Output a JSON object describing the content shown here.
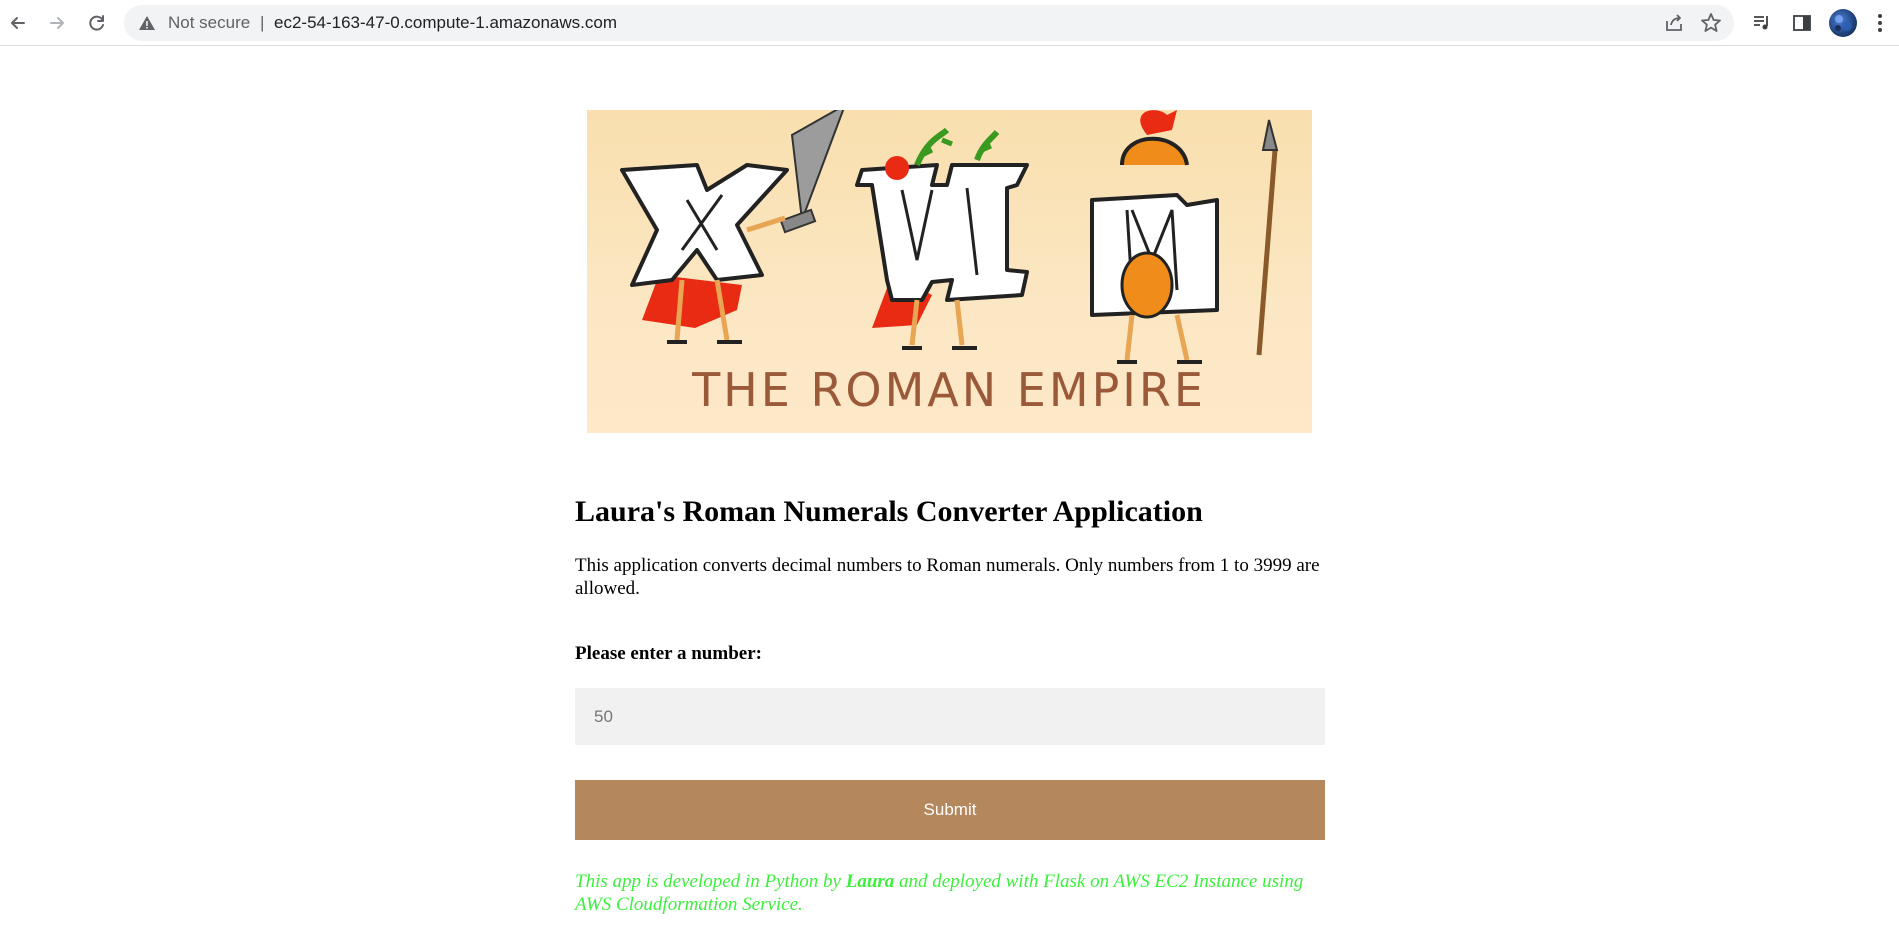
{
  "browser": {
    "security_label": "Not secure",
    "separator": "|",
    "url": "ec2-54-163-47-0.compute-1.amazonaws.com"
  },
  "banner": {
    "caption": "THE ROMAN EMPIRE",
    "letters": [
      "X",
      "VI",
      "M"
    ]
  },
  "page": {
    "title": "Laura's Roman Numerals Converter Application",
    "description": "This application converts decimal numbers to Roman numerals. Only numbers from 1 to 3999 are allowed.",
    "input_label": "Please enter a number:",
    "input_placeholder": "50",
    "submit_label": "Submit",
    "footer_prefix": "This app is developed in Python by ",
    "footer_author": "Laura",
    "footer_suffix": " and deployed with Flask on AWS EC2 Instance using AWS Cloudformation Service."
  },
  "colors": {
    "submit_bg": "#b5875c",
    "footer_text": "#3cf03c",
    "banner_bg": "#fbe3b6",
    "banner_caption": "#9a5a3a"
  }
}
